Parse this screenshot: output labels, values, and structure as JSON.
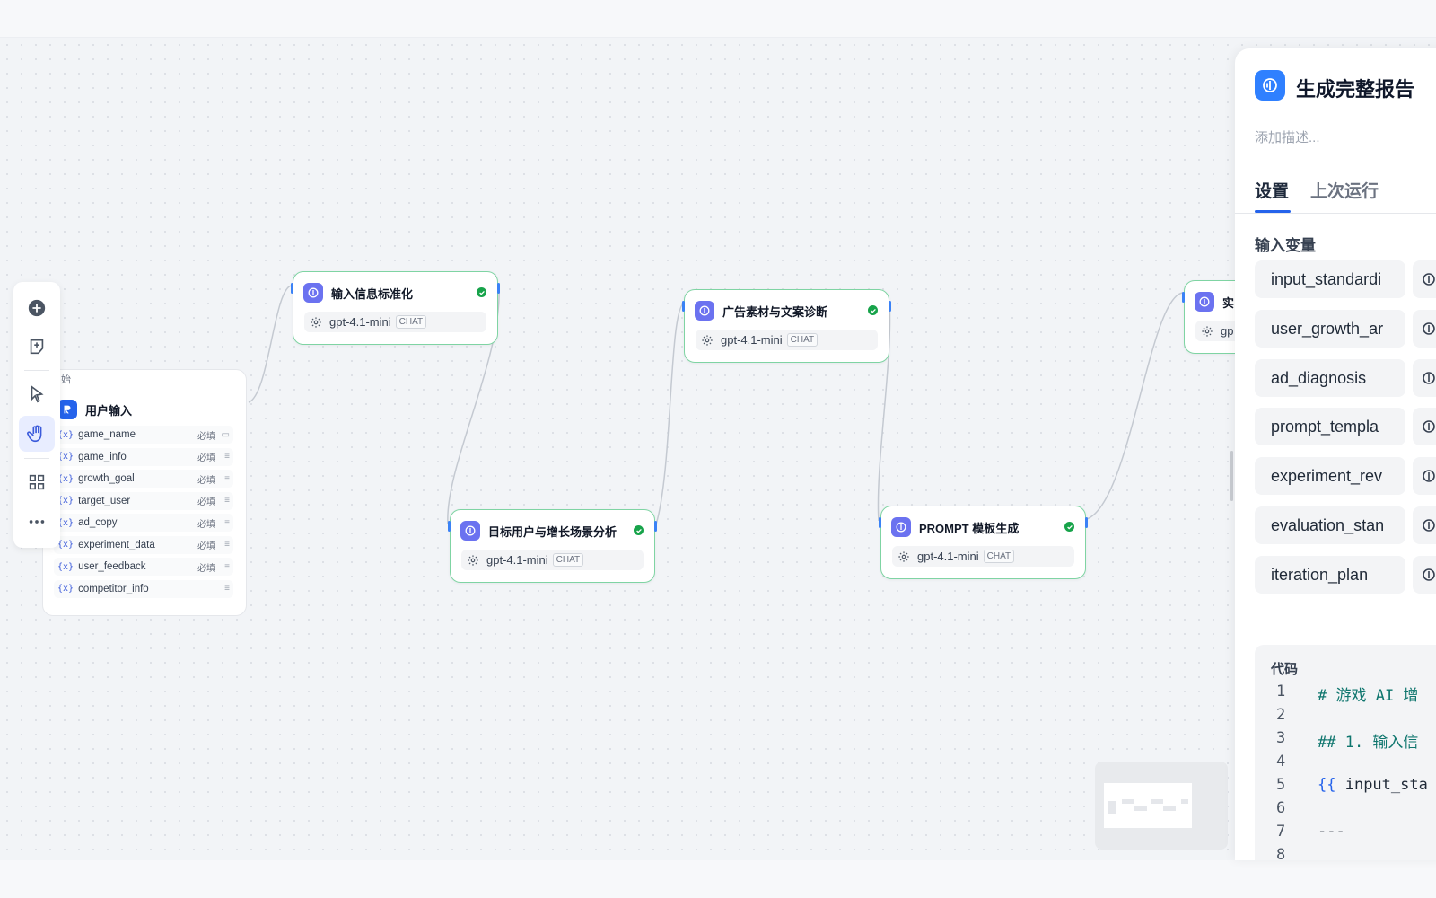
{
  "toolbar": {
    "tools": [
      "add-node-icon",
      "add-note-icon",
      "pointer-icon",
      "hand-icon",
      "organize-icon",
      "more-icon"
    ],
    "active": "hand-icon"
  },
  "start_node": {
    "header_fragment": "始",
    "title": "用户输入",
    "variables": [
      {
        "prefix": "{x}",
        "name": "game_name",
        "required": "必填",
        "type_icon": "text-icon"
      },
      {
        "prefix": "{x}",
        "name": "game_info",
        "required": "必填",
        "type_icon": "paragraph-icon"
      },
      {
        "prefix": "{x}",
        "name": "growth_goal",
        "required": "必填",
        "type_icon": "paragraph-icon"
      },
      {
        "prefix": "{x}",
        "name": "target_user",
        "required": "必填",
        "type_icon": "paragraph-icon"
      },
      {
        "prefix": "{x}",
        "name": "ad_copy",
        "required": "必填",
        "type_icon": "paragraph-icon"
      },
      {
        "prefix": "{x}",
        "name": "experiment_data",
        "required": "必填",
        "type_icon": "paragraph-icon"
      },
      {
        "prefix": "{x}",
        "name": "user_feedback",
        "required": "必填",
        "type_icon": "paragraph-icon"
      },
      {
        "prefix": "{x}",
        "name": "competitor_info",
        "required": "",
        "type_icon": "paragraph-icon"
      }
    ]
  },
  "nodes": [
    {
      "id": "normalize",
      "title": "输入信息标准化",
      "model": "gpt-4.1-mini",
      "tag": "CHAT",
      "status": "success"
    },
    {
      "id": "target",
      "title": "目标用户与增长场景分析",
      "model": "gpt-4.1-mini",
      "tag": "CHAT",
      "status": "success"
    },
    {
      "id": "ad",
      "title": "广告素材与文案诊断",
      "model": "gpt-4.1-mini",
      "tag": "CHAT",
      "status": "success"
    },
    {
      "id": "prompt",
      "title": "PROMPT 模板生成",
      "model": "gpt-4.1-mini",
      "tag": "CHAT",
      "status": "success"
    },
    {
      "id": "partial",
      "title": "实",
      "model": "gp",
      "tag": "",
      "status": ""
    }
  ],
  "panel": {
    "title": "生成完整报告",
    "description_placeholder": "添加描述...",
    "tabs": [
      "设置",
      "上次运行"
    ],
    "active_tab": "设置",
    "section_title": "输入变量",
    "input_vars": [
      "input_standardi",
      "user_growth_ar",
      "ad_diagnosis",
      "prompt_templa",
      "experiment_rev",
      "evaluation_stan",
      "iteration_plan"
    ],
    "code_label": "代码",
    "code_lines": [
      {
        "n": "1",
        "text": "# 游戏 AI 增"
      },
      {
        "n": "2",
        "text": ""
      },
      {
        "n": "3",
        "text": "## 1. 输入信"
      },
      {
        "n": "4",
        "text": ""
      },
      {
        "n": "5",
        "text": "{{ input_sta"
      },
      {
        "n": "6",
        "text": ""
      },
      {
        "n": "7",
        "text": "---"
      },
      {
        "n": "8",
        "text": ""
      }
    ]
  },
  "colors": {
    "accent": "#2563eb",
    "node_border_success": "#7fd4a3",
    "node_icon": "#6b72f0",
    "success": "#17a34a"
  }
}
